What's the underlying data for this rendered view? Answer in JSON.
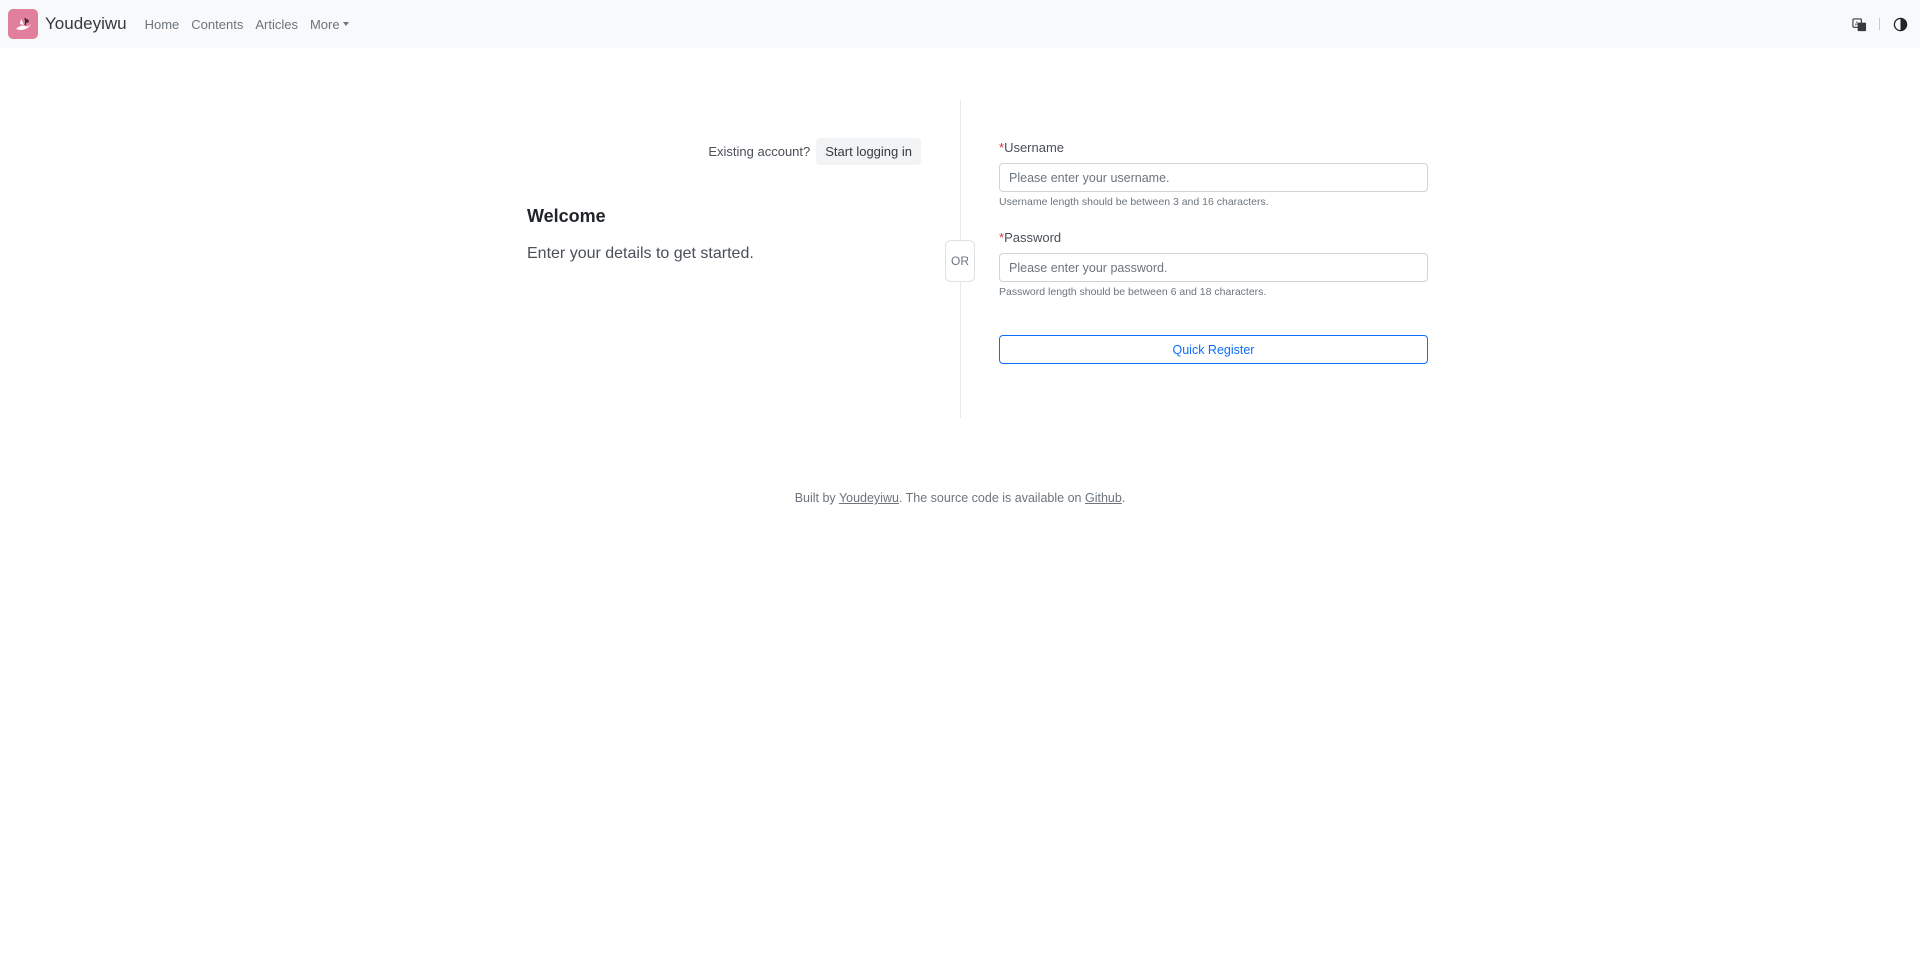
{
  "navbar": {
    "brand_name": "Youdeyiwu",
    "brand_color": "#e27f9d",
    "links": [
      {
        "label": "Home"
      },
      {
        "label": "Contents"
      },
      {
        "label": "Articles"
      },
      {
        "label": "More"
      }
    ],
    "right_icons": [
      "translate-icon",
      "theme-toggle-icon"
    ]
  },
  "main": {
    "existing_label": "Existing account?",
    "login_button": "Start logging in",
    "welcome_title": "Welcome",
    "welcome_subtitle": "Enter your details to get started.",
    "or_text": "OR"
  },
  "form": {
    "required_mark": "*",
    "username": {
      "label": "Username",
      "placeholder": "Please enter your username.",
      "value": "",
      "help": "Username length should be between 3 and 16 characters."
    },
    "password": {
      "label": "Password",
      "placeholder": "Please enter your password.",
      "value": "",
      "help": "Password length should be between 6 and 18 characters."
    },
    "submit_label": "Quick Register",
    "accent_color": "#0d6efd"
  },
  "footer": {
    "prefix": "Built by",
    "author_link": "Youdeyiwu",
    "middle": ". The source code is available on",
    "source_link": "Github",
    "suffix": "."
  }
}
